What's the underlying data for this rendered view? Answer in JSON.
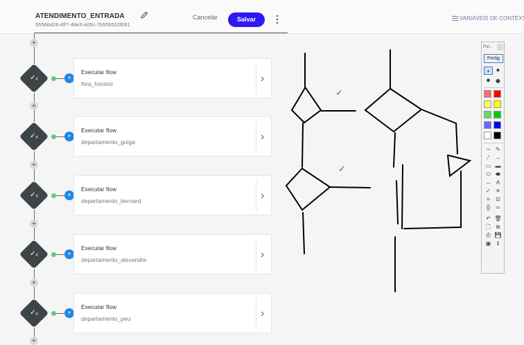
{
  "header": {
    "title": "ATENDIMENTO_ENTRADA",
    "id": "55566d26-4ff7-48e3-a05c-7b55b522f091",
    "cancel_label": "Cancelar",
    "save_label": "Salvar",
    "variables_label": "VARIÁVEIS DE CONTEXTO"
  },
  "flow_nodes": [
    {
      "title": "Executar flow",
      "subtitle": "fora_horario",
      "node_icon": "check-x-icon",
      "link_icon": "flow-link-icon",
      "link_glyph": "»"
    },
    {
      "title": "Executar flow",
      "subtitle": "departamento_guiga",
      "node_icon": "check-x-icon",
      "link_icon": "flow-link-icon",
      "link_glyph": "»"
    },
    {
      "title": "Executar flow",
      "subtitle": "departamento_bernard",
      "node_icon": "check-x-icon",
      "link_icon": "flow-link-icon",
      "link_glyph": "»"
    },
    {
      "title": "Executar flow",
      "subtitle": "departamento_alexandre",
      "node_icon": "check-x-icon",
      "link_icon": "flow-link-icon",
      "link_glyph": "»"
    },
    {
      "title": "Executar flow",
      "subtitle": "departamento_peu",
      "node_icon": "check-x-icon",
      "link_icon": "flow-link-icon",
      "link_glyph": "»"
    }
  ],
  "add_button_glyph": "+",
  "node_glyph": "✓ₓ",
  "chevron_glyph": "›",
  "paint_toolbar": {
    "header": "Poi...",
    "done_label": "Fertig",
    "colors": [
      "#ff6b6b",
      "#ff0000",
      "#ffff66",
      "#ffff00",
      "#66dd66",
      "#00cc00",
      "#6666ff",
      "#0000ff",
      "#ffffff",
      "#000000"
    ],
    "tools": [
      {
        "name": "freehand-icon",
        "glyph": "∼"
      },
      {
        "name": "pencil-icon",
        "glyph": "✎"
      },
      {
        "name": "line-icon",
        "glyph": "⁄"
      },
      {
        "name": "arrow-icon",
        "glyph": "→"
      },
      {
        "name": "rectangle-outline-icon",
        "glyph": "▭"
      },
      {
        "name": "rectangle-filled-icon",
        "glyph": "▬"
      },
      {
        "name": "ellipse-outline-icon",
        "glyph": "⬭"
      },
      {
        "name": "ellipse-filled-icon",
        "glyph": "⬬"
      },
      {
        "name": "double-arrow-icon",
        "glyph": "↔"
      },
      {
        "name": "text-icon",
        "glyph": "A"
      },
      {
        "name": "checkmark-stamp-icon",
        "glyph": "✓"
      },
      {
        "name": "cross-stamp-icon",
        "glyph": "✕"
      },
      {
        "name": "crop-icon",
        "glyph": "⌗"
      },
      {
        "name": "zoom-area-icon",
        "glyph": "⊡"
      },
      {
        "name": "plus-stamp-icon",
        "glyph": "╬"
      },
      {
        "name": "minus-stamp-icon",
        "glyph": "═"
      },
      {
        "name": "undo-icon",
        "glyph": "↶"
      },
      {
        "name": "trash-icon",
        "glyph": "🗑"
      },
      {
        "name": "new-page-icon",
        "glyph": "🗋"
      },
      {
        "name": "copy-icon",
        "glyph": "⧉"
      },
      {
        "name": "print-icon",
        "glyph": "⎙"
      },
      {
        "name": "save-icon",
        "glyph": "💾"
      },
      {
        "name": "screen-icon",
        "glyph": "▣"
      },
      {
        "name": "info-icon",
        "glyph": "ℹ"
      }
    ]
  },
  "annotation_marks": [
    "✓",
    "✓"
  ]
}
